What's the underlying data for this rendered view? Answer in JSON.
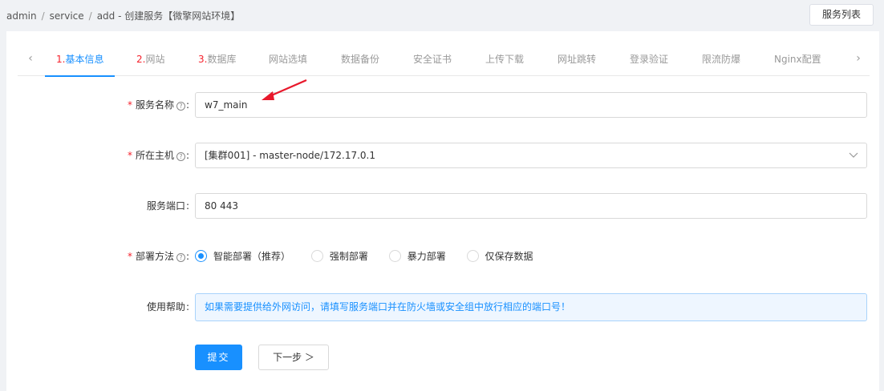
{
  "breadcrumb": {
    "items": [
      "admin",
      "service",
      "add"
    ],
    "separator": "/",
    "title": "- 创建服务【微擎网站环境】"
  },
  "header": {
    "list_button": "服务列表"
  },
  "tabs": {
    "prev_icon": "‹",
    "next_icon": "›",
    "items": [
      {
        "num": "1.",
        "label": "基本信息",
        "active": true
      },
      {
        "num": "2.",
        "label": "网站"
      },
      {
        "num": "3.",
        "label": "数据库"
      },
      {
        "label": "网站选填"
      },
      {
        "label": "数据备份"
      },
      {
        "label": "安全证书"
      },
      {
        "label": "上传下载"
      },
      {
        "label": "网址跳转"
      },
      {
        "label": "登录验证"
      },
      {
        "label": "限流防爆"
      },
      {
        "label": "Nginx配置"
      }
    ]
  },
  "form": {
    "service_name": {
      "label": "服务名称",
      "value": "w7_main",
      "required": true
    },
    "host": {
      "label": "所在主机",
      "value": "[集群001] - master-node/172.17.0.1",
      "required": true
    },
    "port": {
      "label": "服务端口",
      "value": "80 443"
    },
    "deploy": {
      "label": "部署方法",
      "required": true,
      "options": [
        "智能部署（推荐）",
        "强制部署",
        "暴力部署",
        "仅保存数据"
      ],
      "selected": "智能部署（推荐）"
    },
    "help": {
      "label": "使用帮助",
      "text": "如果需要提供给外网访问，请填写服务端口并在防火墙或安全组中放行相应的端口号！"
    },
    "required_mark": "*",
    "help_icon": "?",
    "colon": ":"
  },
  "actions": {
    "submit": "提交",
    "next": "下一步 ＞"
  },
  "colors": {
    "accent": "#1890ff",
    "required": "#f5222d",
    "annotation_arrow": "#e8192c"
  }
}
